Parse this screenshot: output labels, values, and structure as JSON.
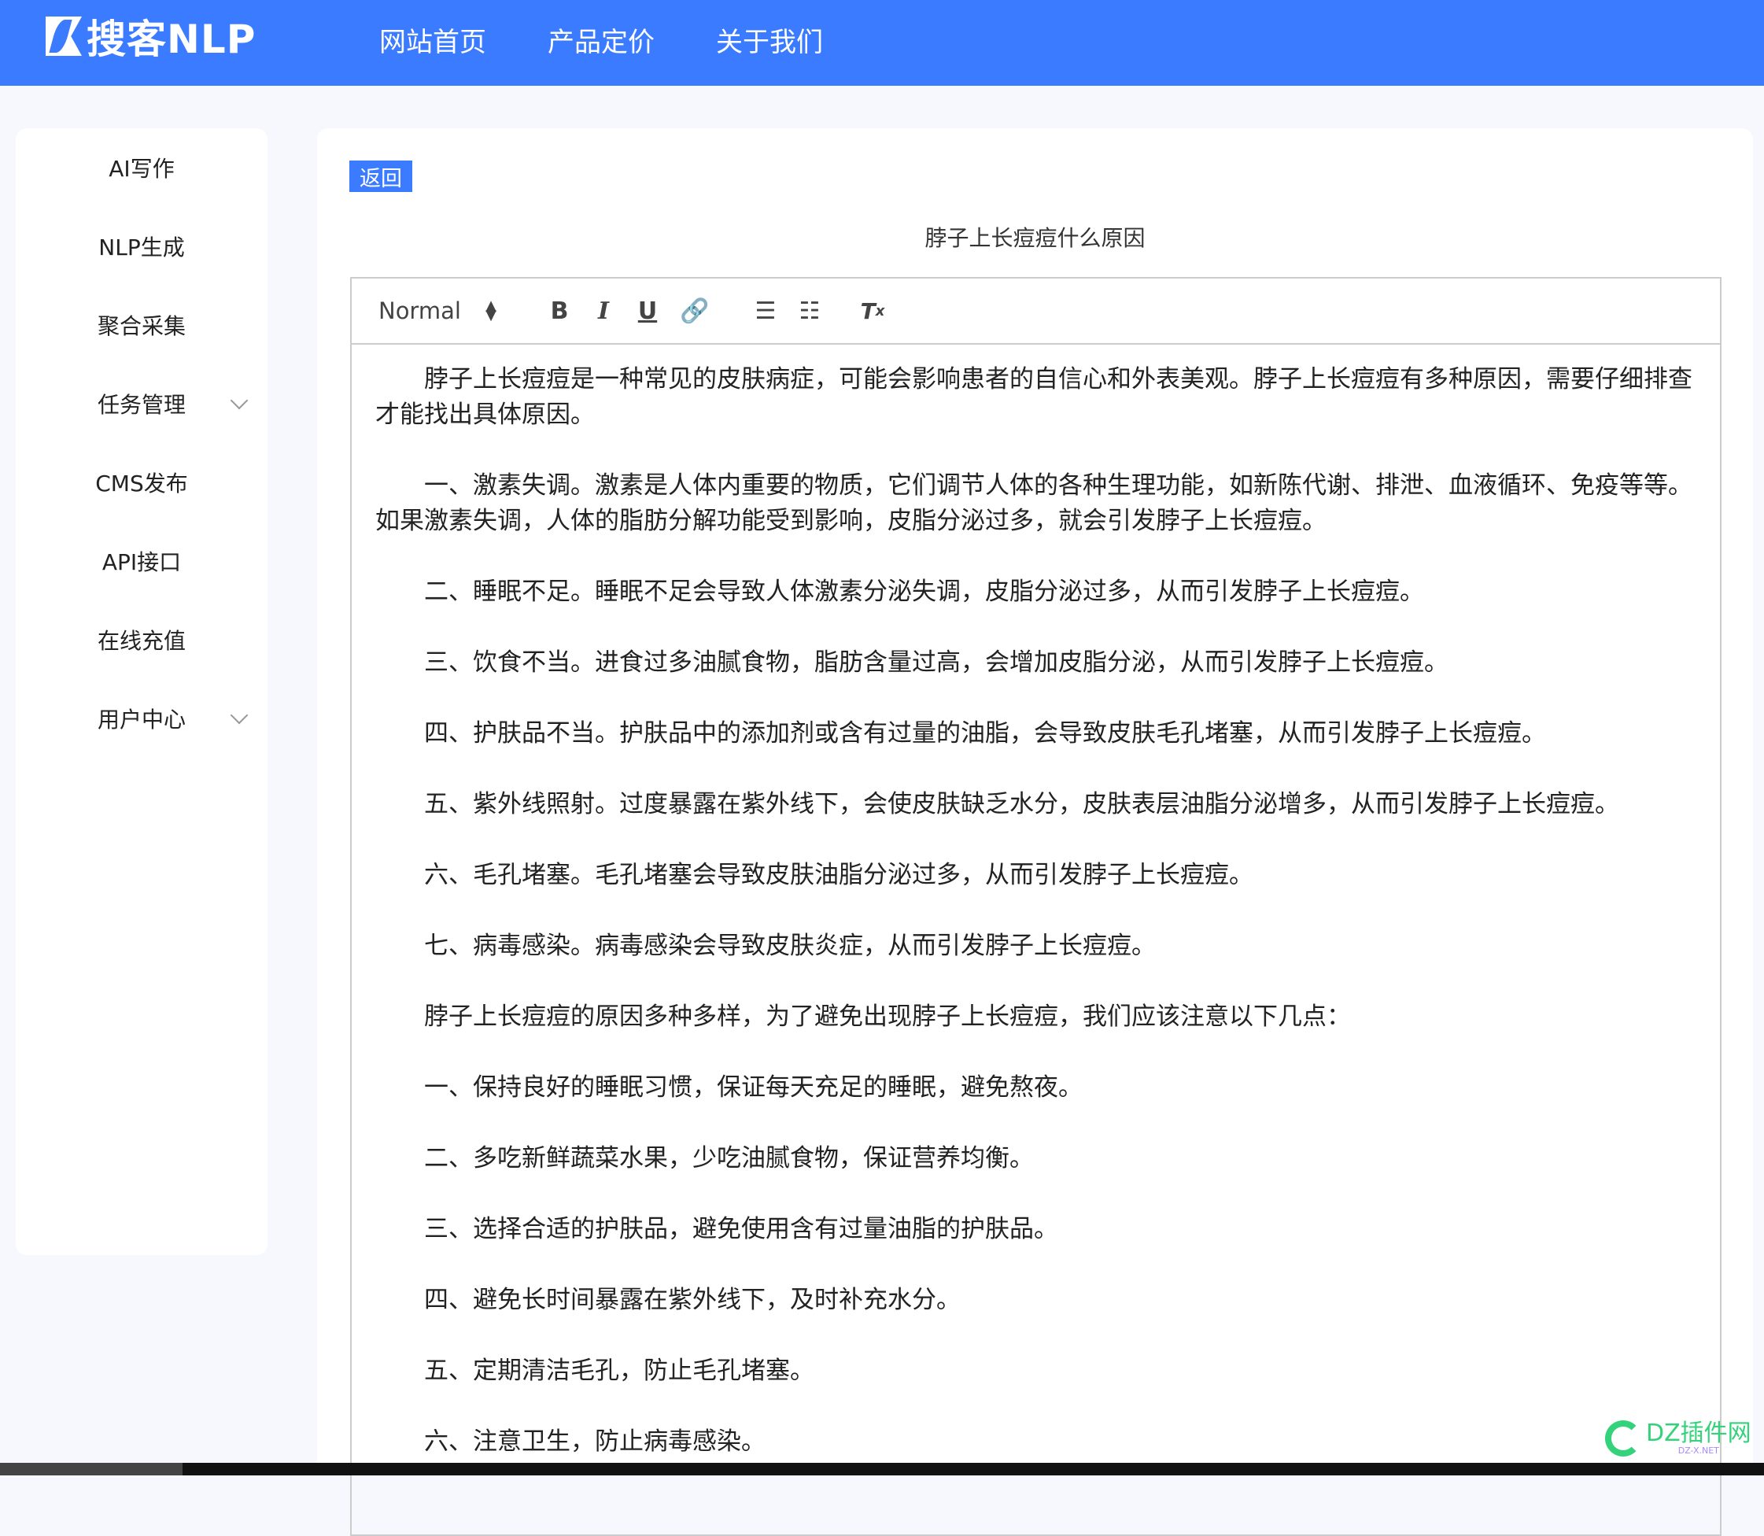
{
  "header": {
    "logo": "搜客NLP",
    "nav": [
      "网站首页",
      "产品定价",
      "关于我们"
    ],
    "color": "#3b7bff"
  },
  "sidebar": {
    "items": [
      {
        "label": "AI写作"
      },
      {
        "label": "NLP生成"
      },
      {
        "label": "聚合采集"
      },
      {
        "label": "任务管理",
        "expandable": true
      },
      {
        "label": "CMS发布"
      },
      {
        "label": "API接口"
      },
      {
        "label": "在线充值"
      },
      {
        "label": "用户中心",
        "expandable": true
      }
    ]
  },
  "main": {
    "back_label": "返回",
    "title": "脖子上长痘痘什么原因",
    "toolbar": {
      "format": "Normal",
      "buttons": [
        "bold-icon",
        "italic-icon",
        "underline-icon",
        "link-icon",
        "ordered-list-icon",
        "bullet-list-icon",
        "clear-format-icon"
      ]
    },
    "paragraphs": [
      "脖子上长痘痘是一种常见的皮肤病症，可能会影响患者的自信心和外表美观。脖子上长痘痘有多种原因，需要仔细排查才能找出具体原因。",
      "一、激素失调。激素是人体内重要的物质，它们调节人体的各种生理功能，如新陈代谢、排泄、血液循环、免疫等等。如果激素失调，人体的脂肪分解功能受到影响，皮脂分泌过多，就会引发脖子上长痘痘。",
      "二、睡眠不足。睡眠不足会导致人体激素分泌失调，皮脂分泌过多，从而引发脖子上长痘痘。",
      "三、饮食不当。进食过多油腻食物，脂肪含量过高，会增加皮脂分泌，从而引发脖子上长痘痘。",
      "四、护肤品不当。护肤品中的添加剂或含有过量的油脂，会导致皮肤毛孔堵塞，从而引发脖子上长痘痘。",
      "五、紫外线照射。过度暴露在紫外线下，会使皮肤缺乏水分，皮肤表层油脂分泌增多，从而引发脖子上长痘痘。",
      "六、毛孔堵塞。毛孔堵塞会导致皮肤油脂分泌过多，从而引发脖子上长痘痘。",
      "七、病毒感染。病毒感染会导致皮肤炎症，从而引发脖子上长痘痘。",
      "脖子上长痘痘的原因多种多样，为了避免出现脖子上长痘痘，我们应该注意以下几点：",
      "一、保持良好的睡眠习惯，保证每天充足的睡眠，避免熬夜。",
      "二、多吃新鲜蔬菜水果，少吃油腻食物，保证营养均衡。",
      "三、选择合适的护肤品，避免使用含有过量油脂的护肤品。",
      "四、避免长时间暴露在紫外线下，及时补充水分。",
      "五、定期清洁毛孔，防止毛孔堵塞。",
      "六、注意卫生，防止病毒感染。"
    ]
  },
  "watermark": {
    "text": "DZ插件网",
    "sub": "DZ-X.NET"
  }
}
